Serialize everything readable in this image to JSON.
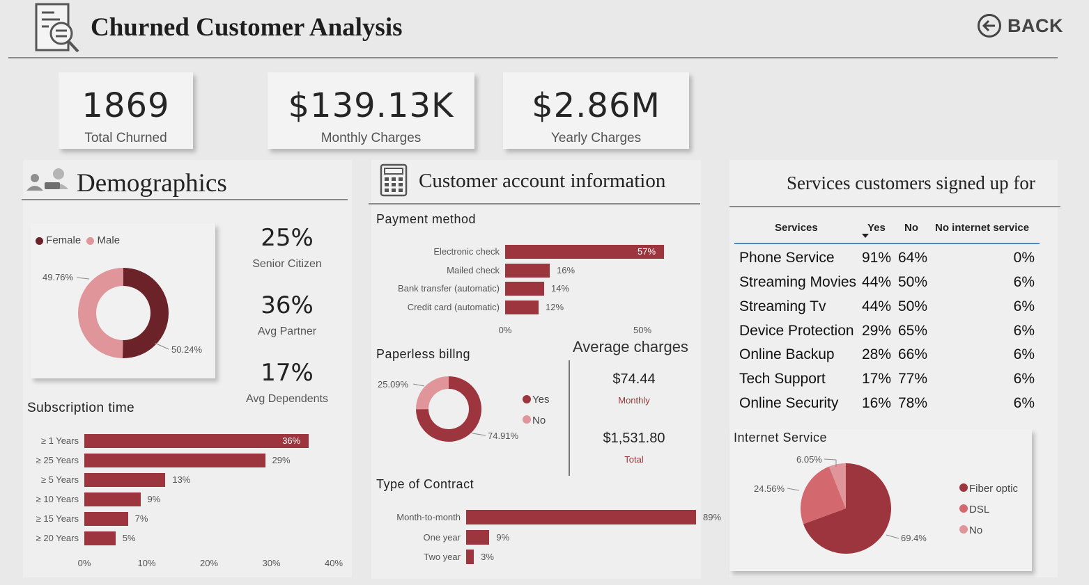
{
  "header": {
    "title": "Churned Customer Analysis",
    "back_label": "BACK"
  },
  "kpis": [
    {
      "value": "1869",
      "label": "Total Churned"
    },
    {
      "value": "$139.13K",
      "label": "Monthly Charges"
    },
    {
      "value": "$2.86M",
      "label": "Yearly Charges"
    }
  ],
  "demographics": {
    "title": "Demographics",
    "stats": [
      {
        "value": "25%",
        "label": "Senior Citizen"
      },
      {
        "value": "36%",
        "label": "Avg Partner"
      },
      {
        "value": "17%",
        "label": "Avg Dependents"
      }
    ],
    "gender_legend": [
      "Female",
      "Male"
    ]
  },
  "account": {
    "title": "Customer account information"
  },
  "services": {
    "title": "Services customers signed up for",
    "columns": [
      "Services",
      "Yes",
      "No",
      "No internet service"
    ],
    "rows": [
      [
        "Phone Service",
        "91%",
        "64%",
        "0%"
      ],
      [
        "Streaming Movies",
        "44%",
        "50%",
        "6%"
      ],
      [
        "Streaming Tv",
        "44%",
        "50%",
        "6%"
      ],
      [
        "Device Protection",
        "29%",
        "65%",
        "6%"
      ],
      [
        "Online Backup",
        "28%",
        "66%",
        "6%"
      ],
      [
        "Tech Support",
        "17%",
        "77%",
        "6%"
      ],
      [
        "Online Security",
        "16%",
        "78%",
        "6%"
      ]
    ]
  },
  "average_charges": {
    "title": "Average charges",
    "monthly_value": "$74.44",
    "monthly_label": "Monthly",
    "total_value": "$1,531.80",
    "total_label": "Total"
  },
  "colors": {
    "primary": "#9c353d",
    "dark": "#6b2229",
    "light": "#e0959a",
    "mid": "#d4686f"
  },
  "chart_data": [
    {
      "id": "gender",
      "type": "pie",
      "donut": true,
      "categories": [
        "Female",
        "Male"
      ],
      "values": [
        49.76,
        50.24
      ],
      "value_labels": [
        "49.76%",
        "50.24%"
      ]
    },
    {
      "id": "subscription",
      "type": "bar",
      "orientation": "horizontal",
      "title": "Subscription time",
      "categories": [
        "≥ 1 Years",
        "≥ 25 Years",
        "≥ 5 Years",
        "≥ 10 Years",
        "≥ 15 Years",
        "≥ 20 Years"
      ],
      "values": [
        36,
        29,
        13,
        9,
        7,
        5
      ],
      "value_labels": [
        "36%",
        "29%",
        "13%",
        "9%",
        "7%",
        "5%"
      ],
      "xlim": [
        0,
        40
      ],
      "ticks": [
        "0%",
        "10%",
        "20%",
        "30%",
        "40%"
      ]
    },
    {
      "id": "payment",
      "type": "bar",
      "orientation": "horizontal",
      "title": "Payment method",
      "categories": [
        "Electronic check",
        "Mailed check",
        "Bank transfer (automatic)",
        "Credit card (automatic)"
      ],
      "values": [
        57,
        16,
        14,
        12
      ],
      "value_labels": [
        "57%",
        "16%",
        "14%",
        "12%"
      ],
      "xlim": [
        0,
        60
      ],
      "ticks": [
        "0%",
        "50%"
      ]
    },
    {
      "id": "paperless",
      "type": "pie",
      "donut": true,
      "title": "Paperless billng",
      "categories": [
        "Yes",
        "No"
      ],
      "values": [
        74.91,
        25.09
      ],
      "value_labels": [
        "74.91%",
        "25.09%"
      ]
    },
    {
      "id": "contract",
      "type": "bar",
      "orientation": "horizontal",
      "title": "Type of Contract",
      "categories": [
        "Month-to-month",
        "One year",
        "Two year"
      ],
      "values": [
        89,
        9,
        3
      ],
      "value_labels": [
        "89%",
        "9%",
        "3%"
      ]
    },
    {
      "id": "internet",
      "type": "pie",
      "title": "Internet Service",
      "categories": [
        "Fiber optic",
        "DSL",
        "No"
      ],
      "values": [
        69.4,
        24.56,
        6.05
      ],
      "value_labels": [
        "69.4%",
        "24.56%",
        "6.05%"
      ]
    }
  ]
}
